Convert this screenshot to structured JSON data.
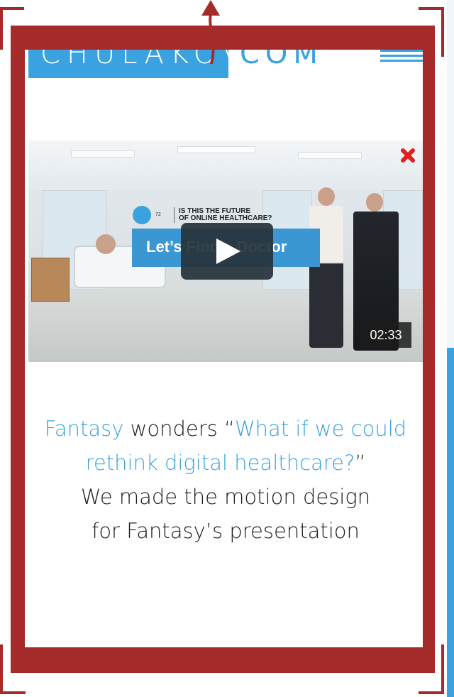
{
  "header": {
    "logo_left": "CHULAKOV",
    "logo_right": "COM",
    "menu_icon": "hamburger-menu-icon"
  },
  "video": {
    "overlay_number": "72",
    "overlay_title": "IS THIS THE FUTURE\nOF ONLINE HEALTHCARE?",
    "overlay_banner": "Let’s Find a Doctor",
    "duration": "02:33",
    "play_icon": "play-icon",
    "close_icon": "close-icon"
  },
  "description": {
    "line1_brand": "Fantasy",
    "line1_mid": " wonders “",
    "line1_quote": "What if we could rethink digital healthcare?",
    "line1_end": "”",
    "line2": "We made the motion design",
    "line3": "for Fantasy’s presentation"
  },
  "colors": {
    "accent": "#3aa2de",
    "frame": "#a52a2a",
    "text": "#1c1c1c"
  }
}
